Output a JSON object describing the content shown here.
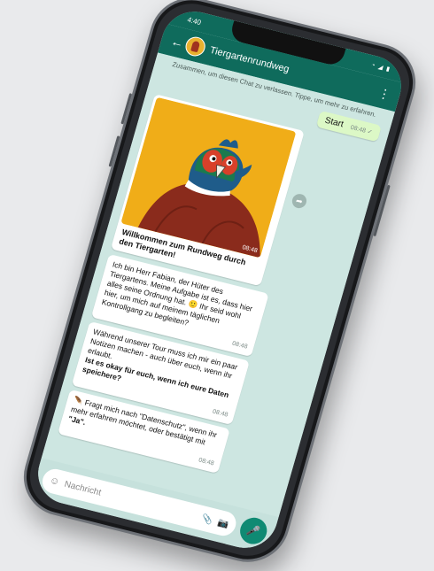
{
  "status": {
    "time": "4:40",
    "icons": "◔ ◢ ▮"
  },
  "header": {
    "title": "Tiergartenrundweg",
    "back": "←",
    "menu": "⋮"
  },
  "chat": {
    "system_note": "Zusammen, um diesen Chat zu verlassen. Tippe, um mehr zu erfahren.",
    "start": {
      "text": "Start",
      "time": "08:48 ✓"
    },
    "image": {
      "time": "08:48",
      "caption": "Willkommen zum Rundweg durch den Tiergarten!"
    },
    "msg1": {
      "text": "Ich bin Herr Fabian, der Hüter des Tiergartens. Meine Aufgabe ist es, dass hier alles seine Ordnung hat. 🙂 Ihr seid wohl hier, um mich auf meinem täglichen Kontrollgang zu begleiten?",
      "time": "08:48"
    },
    "msg2": {
      "text": "Während unserer Tour muss ich mir ein paar Notizen machen - auch über euch, wenn ihr erlaubt.",
      "bold": "Ist es okay für euch, wenn ich eure Daten speichere?",
      "time": "08:48"
    },
    "msg3": {
      "pre": "🪶 Fragt mich nach \"Datenschutz\", wenn ihr mehr erfahren möchtet, oder bestätigt mit",
      "bold": "\"Ja\".",
      "time": "08:48"
    }
  },
  "composer": {
    "placeholder": "Nachricht",
    "emoji": "☺",
    "attach": "📎",
    "camera": "📷",
    "mic": "🎤"
  },
  "colors": {
    "header": "#0f6b5c",
    "chat_bg": "#cde6e1",
    "outgoing": "#dcf8c6",
    "image_bg": "#f0ad18",
    "mic": "#0f8a73"
  }
}
